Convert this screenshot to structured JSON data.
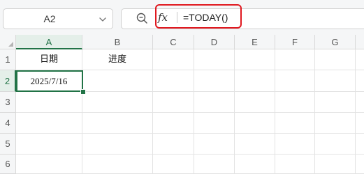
{
  "formula_bar": {
    "name_box": "A2",
    "formula": "=TODAY()",
    "fx_label": "fx"
  },
  "columns": [
    "A",
    "B",
    "C",
    "D",
    "E",
    "F",
    "G"
  ],
  "rows": [
    "1",
    "2",
    "3",
    "4",
    "5",
    "6"
  ],
  "cells": {
    "A1": "日期",
    "B1": "进度",
    "A2": "2025/7/16"
  },
  "selection": {
    "active_cell": "A2"
  },
  "colors": {
    "accent": "#217346",
    "highlight_box": "#e0181f"
  },
  "icons": {
    "namebox_dropdown": "chevron-down-icon",
    "zoom": "zoom-icon",
    "function": "fx-icon",
    "select_all": "select-all-triangle-icon"
  }
}
